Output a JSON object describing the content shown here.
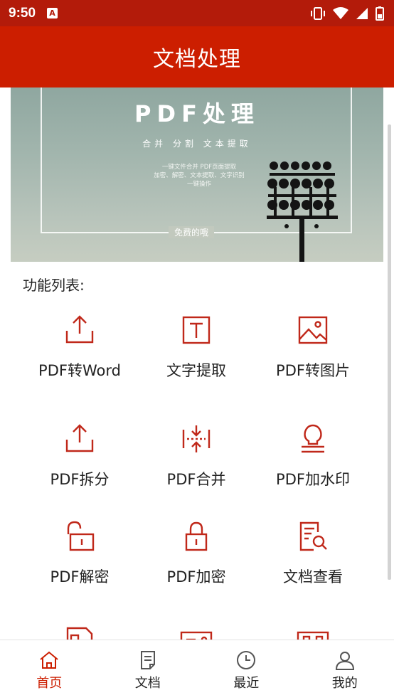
{
  "status_bar": {
    "time": "9:50",
    "notif_letter": "A"
  },
  "header": {
    "title": "文档处理"
  },
  "banner": {
    "title": "PDF处理",
    "subtitle": "合并 分割 文本提取",
    "line1": "一键文件合并 PDF页面提取",
    "line2": "加密、解密、文本提取、文字识别",
    "line3": "一键操作",
    "free_text": "免费的哦"
  },
  "section_label": "功能列表:",
  "features": [
    {
      "label": "PDF转Word",
      "icon": "upload-tray-icon"
    },
    {
      "label": "文字提取",
      "icon": "text-box-icon"
    },
    {
      "label": "PDF转图片",
      "icon": "image-icon"
    },
    {
      "label": "PDF拆分",
      "icon": "upload-tray-icon"
    },
    {
      "label": "PDF合并",
      "icon": "merge-icon"
    },
    {
      "label": "PDF加水印",
      "icon": "stamp-icon"
    },
    {
      "label": "PDF解密",
      "icon": "unlock-icon"
    },
    {
      "label": "PDF加密",
      "icon": "lock-icon"
    },
    {
      "label": "文档查看",
      "icon": "document-search-icon"
    }
  ],
  "bottom_nav": [
    {
      "label": "首页",
      "icon": "home-icon",
      "active": true
    },
    {
      "label": "文档",
      "icon": "document-icon",
      "active": false
    },
    {
      "label": "最近",
      "icon": "clock-icon",
      "active": false
    },
    {
      "label": "我的",
      "icon": "user-icon",
      "active": false
    }
  ],
  "colors": {
    "primary": "#cc1e00",
    "status_bar": "#b31b0a",
    "icon_red": "#c0281a"
  }
}
